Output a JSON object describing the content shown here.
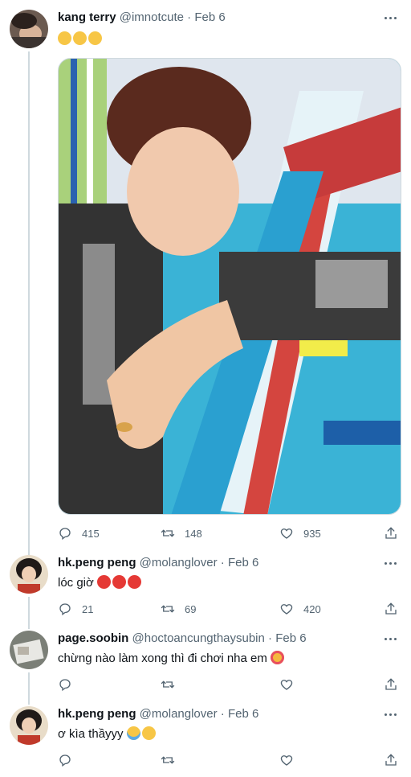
{
  "tweets": [
    {
      "name": "kang terry",
      "handle": "@imnotcute",
      "dot": "·",
      "date": "Feb 6",
      "text": "",
      "emojis": [
        "grinning-sweat-emoji",
        "grinning-sweat-emoji",
        "grinning-sweat-emoji"
      ],
      "reply_count": "415",
      "retweet_count": "148",
      "like_count": "935"
    },
    {
      "name": "hk.peng peng",
      "handle": "@molanglover",
      "dot": "·",
      "date": "Feb 6",
      "text": "lóc giờ",
      "emojis": [
        "devil-emoji",
        "devil-emoji",
        "devil-emoji"
      ],
      "reply_count": "21",
      "retweet_count": "69",
      "like_count": "420"
    },
    {
      "name": "page.soobin",
      "handle": "@hoctoancungthaysubin",
      "dot": "·",
      "date": "Feb 6",
      "text": "chừng nào làm xong thì đi chơi nha em",
      "emojis": [
        "smiling-hearts-emoji"
      ],
      "reply_count": "",
      "retweet_count": "",
      "like_count": ""
    },
    {
      "name": "hk.peng peng",
      "handle": "@molanglover",
      "dot": "·",
      "date": "Feb 6",
      "text": "ơ kìa thầyyy",
      "emojis": [
        "loudly-crying-emoji",
        "smiling-blush-emoji"
      ],
      "reply_count": "",
      "retweet_count": "",
      "like_count": ""
    }
  ],
  "colors": {
    "text": "#0f1419",
    "secondary": "#536471",
    "border": "#cfd9de"
  }
}
